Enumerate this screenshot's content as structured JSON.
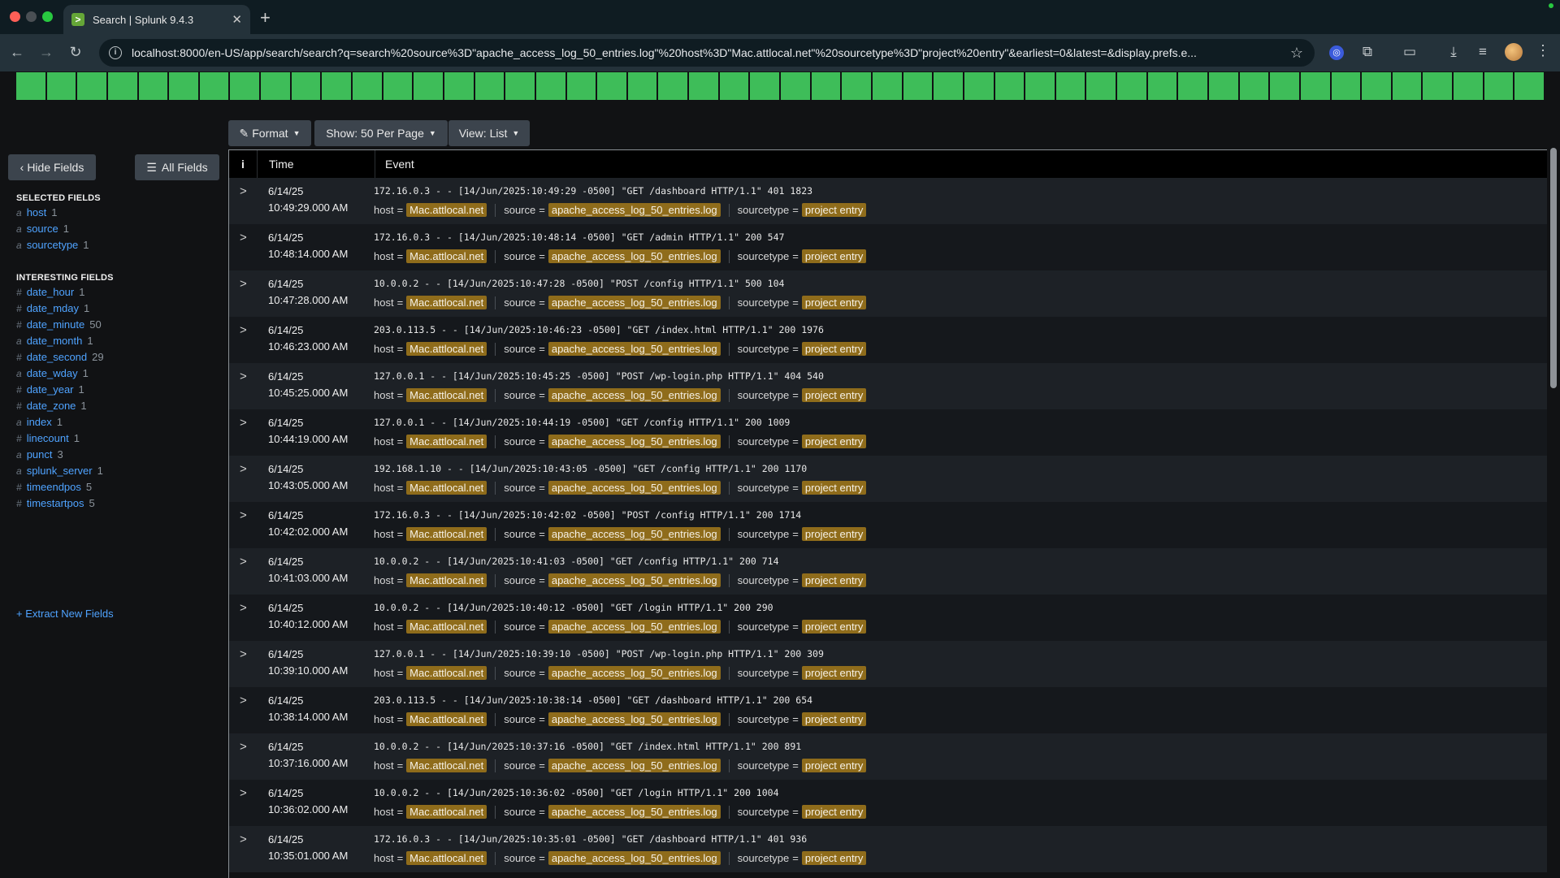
{
  "browser": {
    "tab_title": "Search | Splunk 9.4.3",
    "tab_icon": "splunk-icon",
    "url": "localhost:8000/en-US/app/search/search?q=search%20source%3D\"apache_access_log_50_entries.log\"%20host%3D\"Mac.attlocal.net\"%20sourcetype%3D\"project%20entry\"&earliest=0&latest=&display.prefs.e..."
  },
  "controls": {
    "format": "Format",
    "show": "Show: 50 Per Page",
    "view": "View: List"
  },
  "sidebar": {
    "hide_fields": "Hide Fields",
    "all_fields": "All Fields",
    "selected_heading": "SELECTED FIELDS",
    "selected": [
      {
        "type": "a",
        "name": "host",
        "count": "1"
      },
      {
        "type": "a",
        "name": "source",
        "count": "1"
      },
      {
        "type": "a",
        "name": "sourcetype",
        "count": "1"
      }
    ],
    "interesting_heading": "INTERESTING FIELDS",
    "interesting": [
      {
        "type": "#",
        "name": "date_hour",
        "count": "1"
      },
      {
        "type": "#",
        "name": "date_mday",
        "count": "1"
      },
      {
        "type": "#",
        "name": "date_minute",
        "count": "50"
      },
      {
        "type": "a",
        "name": "date_month",
        "count": "1"
      },
      {
        "type": "#",
        "name": "date_second",
        "count": "29"
      },
      {
        "type": "a",
        "name": "date_wday",
        "count": "1"
      },
      {
        "type": "#",
        "name": "date_year",
        "count": "1"
      },
      {
        "type": "#",
        "name": "date_zone",
        "count": "1"
      },
      {
        "type": "a",
        "name": "index",
        "count": "1"
      },
      {
        "type": "#",
        "name": "linecount",
        "count": "1"
      },
      {
        "type": "a",
        "name": "punct",
        "count": "3"
      },
      {
        "type": "a",
        "name": "splunk_server",
        "count": "1"
      },
      {
        "type": "#",
        "name": "timeendpos",
        "count": "5"
      },
      {
        "type": "#",
        "name": "timestartpos",
        "count": "5"
      }
    ],
    "extract": "+ Extract New Fields"
  },
  "table": {
    "col_i": "i",
    "col_time": "Time",
    "col_event": "Event",
    "meta_labels": {
      "host": "host",
      "source": "source",
      "sourcetype": "sourcetype",
      "eq": "="
    },
    "meta_values": {
      "host": "Mac.attlocal.net",
      "source": "apache_access_log_50_entries.log",
      "sourcetype": "project entry"
    },
    "rows": [
      {
        "date": "6/14/25",
        "time": "10:49:29.000 AM",
        "raw": "172.16.0.3 - - [14/Jun/2025:10:49:29 -0500] \"GET /dashboard HTTP/1.1\" 401 1823"
      },
      {
        "date": "6/14/25",
        "time": "10:48:14.000 AM",
        "raw": "172.16.0.3 - - [14/Jun/2025:10:48:14 -0500] \"GET /admin HTTP/1.1\" 200 547"
      },
      {
        "date": "6/14/25",
        "time": "10:47:28.000 AM",
        "raw": "10.0.0.2 - - [14/Jun/2025:10:47:28 -0500] \"POST /config HTTP/1.1\" 500 104"
      },
      {
        "date": "6/14/25",
        "time": "10:46:23.000 AM",
        "raw": "203.0.113.5 - - [14/Jun/2025:10:46:23 -0500] \"GET /index.html HTTP/1.1\" 200 1976"
      },
      {
        "date": "6/14/25",
        "time": "10:45:25.000 AM",
        "raw": "127.0.0.1 - - [14/Jun/2025:10:45:25 -0500] \"POST /wp-login.php HTTP/1.1\" 404 540"
      },
      {
        "date": "6/14/25",
        "time": "10:44:19.000 AM",
        "raw": "127.0.0.1 - - [14/Jun/2025:10:44:19 -0500] \"GET /config HTTP/1.1\" 200 1009"
      },
      {
        "date": "6/14/25",
        "time": "10:43:05.000 AM",
        "raw": "192.168.1.10 - - [14/Jun/2025:10:43:05 -0500] \"GET /config HTTP/1.1\" 200 1170"
      },
      {
        "date": "6/14/25",
        "time": "10:42:02.000 AM",
        "raw": "172.16.0.3 - - [14/Jun/2025:10:42:02 -0500] \"POST /config HTTP/1.1\" 200 1714"
      },
      {
        "date": "6/14/25",
        "time": "10:41:03.000 AM",
        "raw": "10.0.0.2 - - [14/Jun/2025:10:41:03 -0500] \"GET /config HTTP/1.1\" 200 714"
      },
      {
        "date": "6/14/25",
        "time": "10:40:12.000 AM",
        "raw": "10.0.0.2 - - [14/Jun/2025:10:40:12 -0500] \"GET /login HTTP/1.1\" 200 290"
      },
      {
        "date": "6/14/25",
        "time": "10:39:10.000 AM",
        "raw": "127.0.0.1 - - [14/Jun/2025:10:39:10 -0500] \"POST /wp-login.php HTTP/1.1\" 200 309"
      },
      {
        "date": "6/14/25",
        "time": "10:38:14.000 AM",
        "raw": "203.0.113.5 - - [14/Jun/2025:10:38:14 -0500] \"GET /dashboard HTTP/1.1\" 200 654"
      },
      {
        "date": "6/14/25",
        "time": "10:37:16.000 AM",
        "raw": "10.0.0.2 - - [14/Jun/2025:10:37:16 -0500] \"GET /index.html HTTP/1.1\" 200 891"
      },
      {
        "date": "6/14/25",
        "time": "10:36:02.000 AM",
        "raw": "10.0.0.2 - - [14/Jun/2025:10:36:02 -0500] \"GET /login HTTP/1.1\" 200 1004"
      },
      {
        "date": "6/14/25",
        "time": "10:35:01.000 AM",
        "raw": "172.16.0.3 - - [14/Jun/2025:10:35:01 -0500] \"GET /dashboard HTTP/1.1\" 401 936"
      }
    ]
  },
  "colors": {
    "timeline_bar": "#3ebd59",
    "field_highlight": "#8f6c1b",
    "link": "#4fa3ff"
  }
}
